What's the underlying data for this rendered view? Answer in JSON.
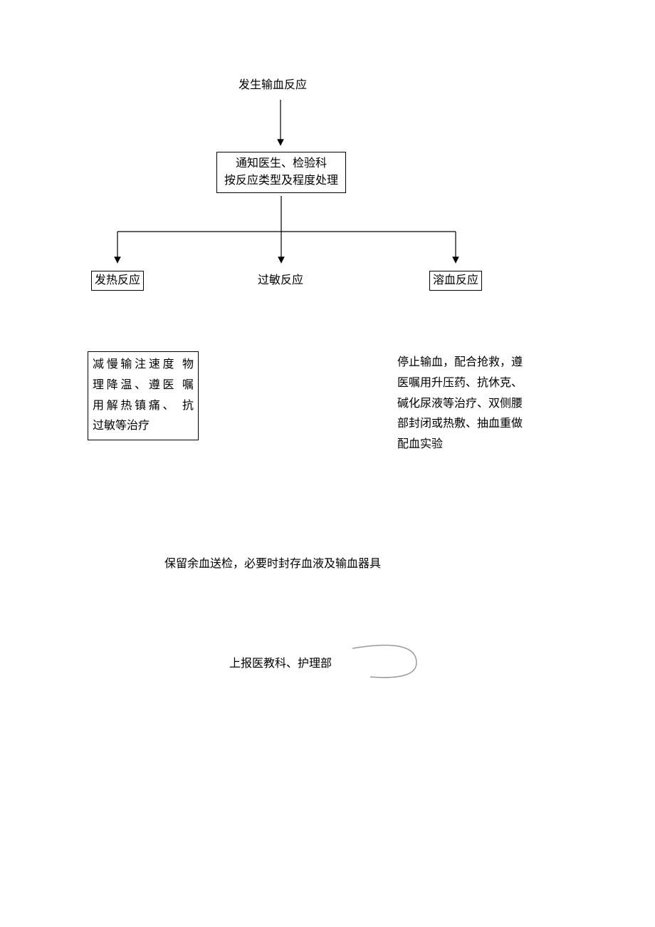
{
  "chart_data": {
    "type": "flowchart",
    "nodes": [
      {
        "id": "start",
        "label": "发生输血反应",
        "boxed": false
      },
      {
        "id": "notify",
        "label_line1": "通知医生、检验科",
        "label_line2": "按反应类型及程度处理",
        "boxed": true
      },
      {
        "id": "fever",
        "label": "发热反应",
        "boxed": true
      },
      {
        "id": "allergy",
        "label": "过敏反应",
        "boxed": false
      },
      {
        "id": "hemolysis",
        "label": "溶血反应",
        "boxed": true
      },
      {
        "id": "fever_treat",
        "label": "减慢输注速度 物理降温、遵医 嘱用解热镇痛、 抗过敏等治疗",
        "boxed": true
      },
      {
        "id": "hemolysis_treat",
        "label": "停止输血，配合抢救，遵医嘱用升压药、抗休克、碱化尿液等治疗、双侧腰部封闭或热敷、抽血重做配血实验",
        "boxed": false
      },
      {
        "id": "preserve",
        "label": "保留余血送检，必要时封存血液及输血器具",
        "boxed": false
      },
      {
        "id": "report",
        "label": "上报医教科、护理部",
        "boxed": false
      }
    ],
    "edges": [
      {
        "from": "start",
        "to": "notify"
      },
      {
        "from": "notify",
        "to": "fever"
      },
      {
        "from": "notify",
        "to": "allergy"
      },
      {
        "from": "notify",
        "to": "hemolysis"
      }
    ]
  },
  "labels": {
    "start": "发生输血反应",
    "notify_line1": "通知医生、检验科",
    "notify_line2": "按反应类型及程度处理",
    "fever": "发热反应",
    "allergy": "过敏反应",
    "hemolysis": "溶血反应",
    "fever_treat_l1": "减慢输注速度  物",
    "fever_treat_l2": "理降温、遵医  嘱",
    "fever_treat_l3": "用解热镇痛、  抗",
    "fever_treat_l4": "过敏等治疗",
    "hemo_treat_l1": "停止输血，配合抢救，遵",
    "hemo_treat_l2": "医嘱用升压药、抗休克、",
    "hemo_treat_l3": "碱化尿液等治疗、双侧腰",
    "hemo_treat_l4": "部封闭或热敷、抽血重做",
    "hemo_treat_l5": "配血实验",
    "preserve": "保留余血送检，必要时封存血液及输血器具",
    "report": "上报医教科、护理部"
  }
}
